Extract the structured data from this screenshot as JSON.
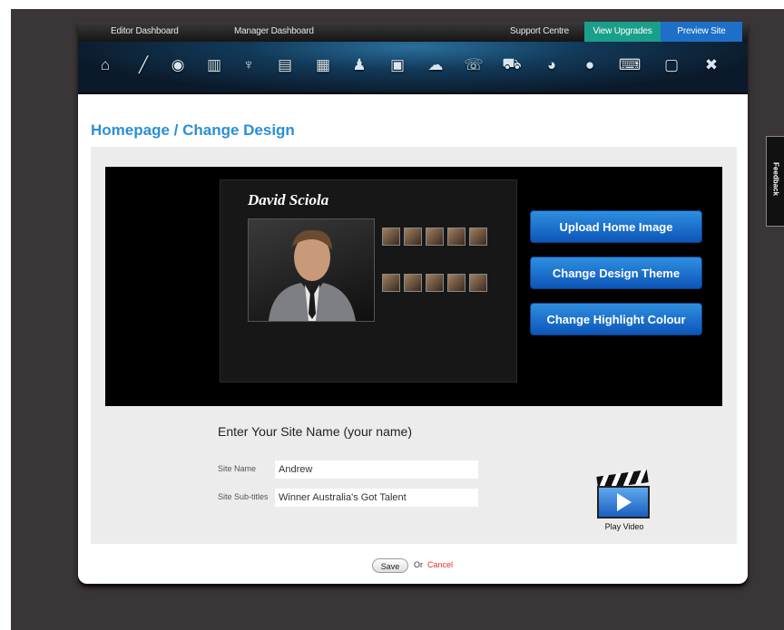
{
  "topnav": {
    "editor_dashboard": "Editor Dashboard",
    "manager_dashboard": "Manager Dashboard",
    "support_centre": "Support Centre",
    "view_upgrades": "View Upgrades",
    "preview_site": "Preview Site"
  },
  "icons": [
    "home-icon",
    "pencil-icon",
    "camera-icon",
    "film-icon",
    "microphone-icon",
    "card-icon",
    "document-icon",
    "person-icon",
    "calendar-icon",
    "chat-icon",
    "phone-icon",
    "cart-icon",
    "pie-chart-icon",
    "globe-icon",
    "keyboard-icon",
    "window-icon",
    "tools-icon"
  ],
  "page": {
    "title": "Homepage / Change Design"
  },
  "preview": {
    "site_name": "David Sciola"
  },
  "design_buttons": {
    "upload": "Upload Home Image",
    "theme": "Change Design Theme",
    "highlight": "Change Highlight Colour"
  },
  "site": {
    "heading": "Enter Your Site Name (your name)",
    "name_label": "Site Name",
    "name_value": "Andrew",
    "subtitle_label": "Site Sub-titles",
    "subtitle_value": "Winner Australia's Got Talent"
  },
  "video": {
    "label": "Play Video"
  },
  "actions": {
    "save": "Save",
    "or": "Or",
    "cancel": "Cancel"
  },
  "feedback": {
    "label": "Feedback"
  },
  "colors": {
    "accent": "#2a8fd4",
    "view_upgrades": "#1aa08a",
    "preview_site": "#1e6fc8",
    "cancel": "#e0302a"
  }
}
